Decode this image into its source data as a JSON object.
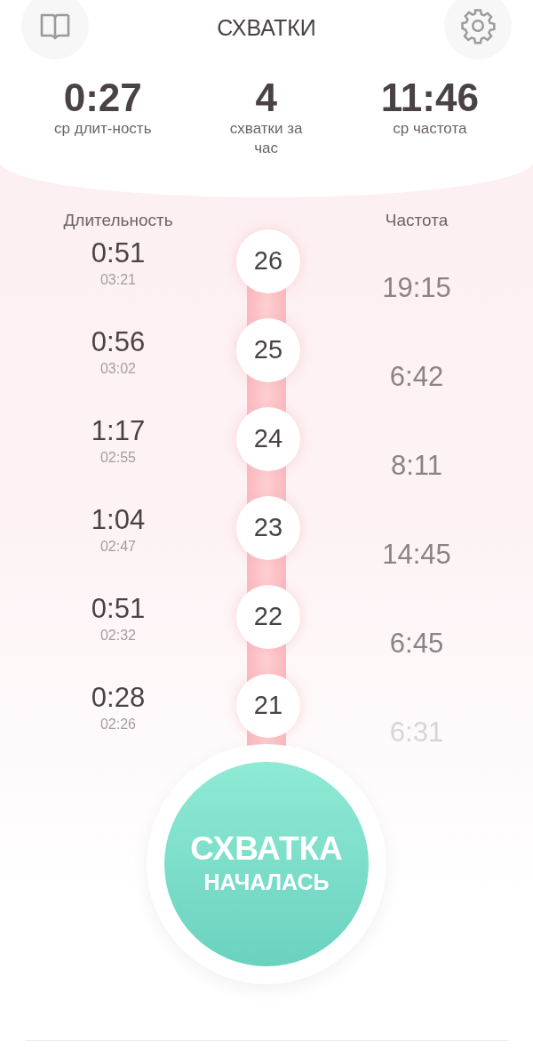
{
  "header": {
    "title": "СХВАТКИ"
  },
  "stats": [
    {
      "value": "0:27",
      "label": "ср длит-ность"
    },
    {
      "value": "4",
      "label": "схватки за час"
    },
    {
      "value": "11:46",
      "label": "ср частота"
    }
  ],
  "columns": {
    "duration": "Длительность",
    "frequency": "Частота"
  },
  "contractions": [
    {
      "number": "26",
      "duration": "0:51",
      "time": "03:21"
    },
    {
      "number": "25",
      "duration": "0:56",
      "time": "03:02"
    },
    {
      "number": "24",
      "duration": "1:17",
      "time": "02:55"
    },
    {
      "number": "23",
      "duration": "1:04",
      "time": "02:47"
    },
    {
      "number": "22",
      "duration": "0:51",
      "time": "02:32"
    },
    {
      "number": "21",
      "duration": "0:28",
      "time": "02:26"
    }
  ],
  "frequencies": [
    "19:15",
    "6:42",
    "8:11",
    "14:45",
    "6:45",
    "6:31"
  ],
  "start_button": {
    "line_1": "СХВАТКА",
    "line_2": "НАЧАЛАСЬ"
  }
}
